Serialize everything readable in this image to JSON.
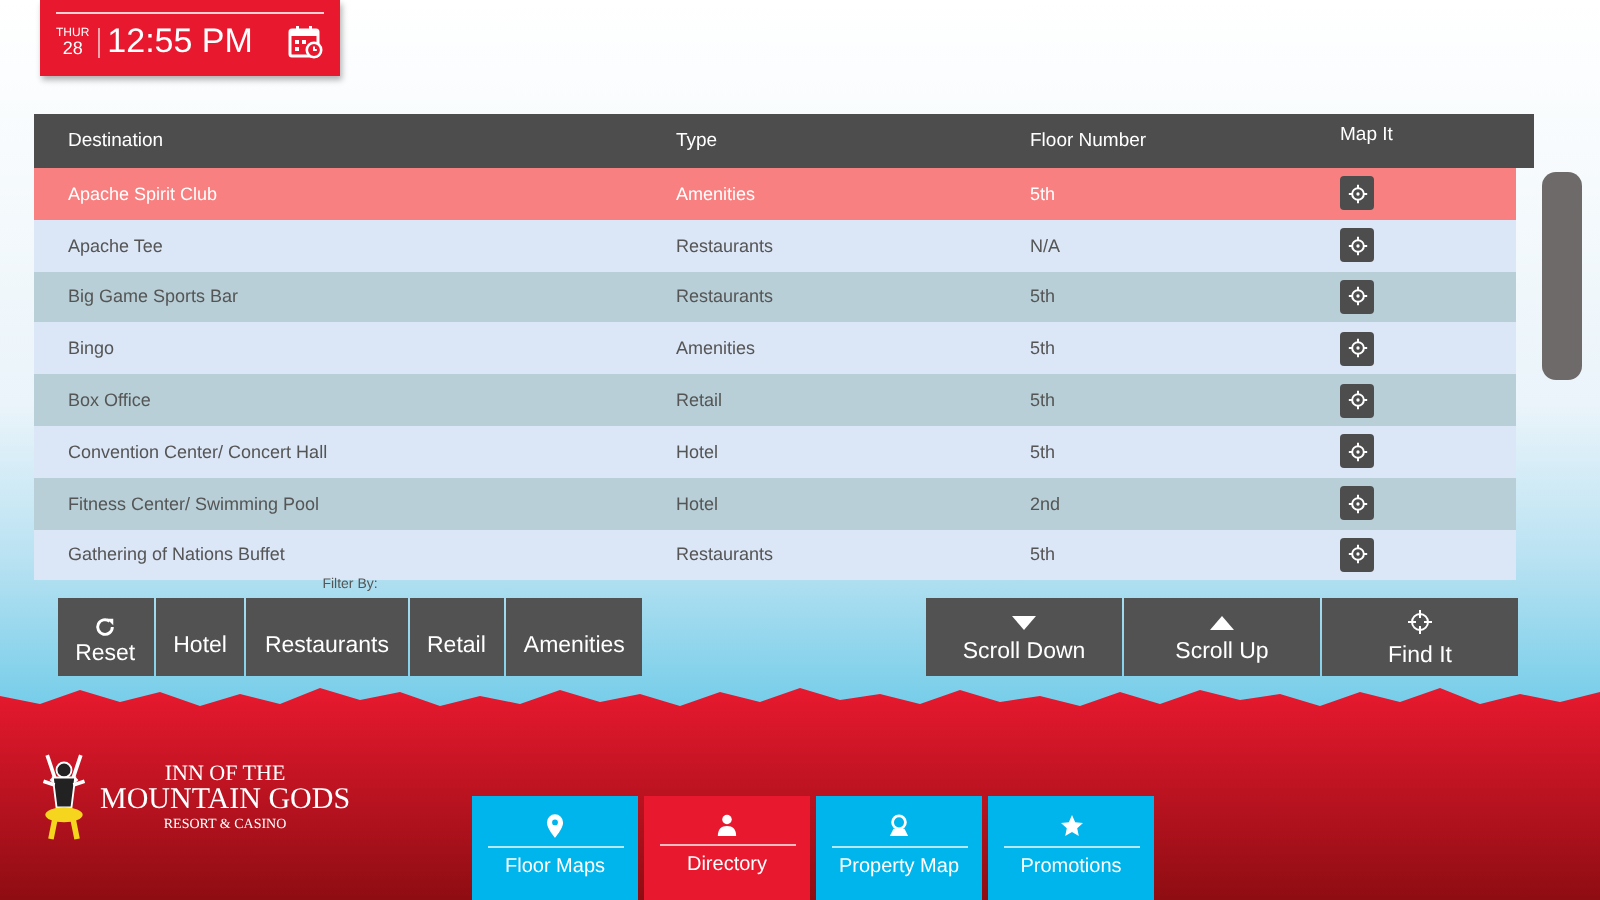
{
  "clock": {
    "day": "THUR",
    "date": "28",
    "time": "12:55 PM"
  },
  "table": {
    "columns": [
      "Destination",
      "Type",
      "Floor Number",
      "Map It"
    ],
    "rows": [
      {
        "destination": "Apache Spirit Club",
        "type": "Amenities",
        "floor": "5th",
        "selected": true
      },
      {
        "destination": "Apache Tee",
        "type": "Restaurants",
        "floor": "N/A",
        "selected": false
      },
      {
        "destination": "Big Game Sports Bar",
        "type": "Restaurants",
        "floor": "5th",
        "selected": false
      },
      {
        "destination": "Bingo",
        "type": "Amenities",
        "floor": "5th",
        "selected": false
      },
      {
        "destination": "Box Office",
        "type": "Retail",
        "floor": "5th",
        "selected": false
      },
      {
        "destination": "Convention Center/ Concert Hall",
        "type": "Hotel",
        "floor": "5th",
        "selected": false
      },
      {
        "destination": "Fitness Center/ Swimming Pool",
        "type": "Hotel",
        "floor": "2nd",
        "selected": false
      },
      {
        "destination": "Gathering of Nations Buffet",
        "type": "Restaurants",
        "floor": "5th",
        "selected": false
      }
    ]
  },
  "filter": {
    "label": "Filter By:",
    "buttons": [
      {
        "label": "Reset",
        "kind": "reset"
      },
      {
        "label": "Hotel",
        "kind": "plain"
      },
      {
        "label": "Restaurants",
        "kind": "plain"
      },
      {
        "label": "Retail",
        "kind": "plain"
      },
      {
        "label": "Amenities",
        "kind": "plain"
      }
    ]
  },
  "actions": [
    {
      "label": "Scroll Down",
      "kind": "down"
    },
    {
      "label": "Scroll Up",
      "kind": "up"
    },
    {
      "label": "Find It",
      "kind": "find"
    }
  ],
  "logo": {
    "line1": "INN OF THE",
    "line2": "MOUNTAIN GODS",
    "line3": "RESORT & CASINO"
  },
  "nav": [
    {
      "label": "Floor Maps",
      "kind": "pin",
      "selected": false
    },
    {
      "label": "Directory",
      "kind": "person",
      "selected": true
    },
    {
      "label": "Property Map",
      "kind": "map",
      "selected": false
    },
    {
      "label": "Promotions",
      "kind": "star",
      "selected": false
    }
  ]
}
